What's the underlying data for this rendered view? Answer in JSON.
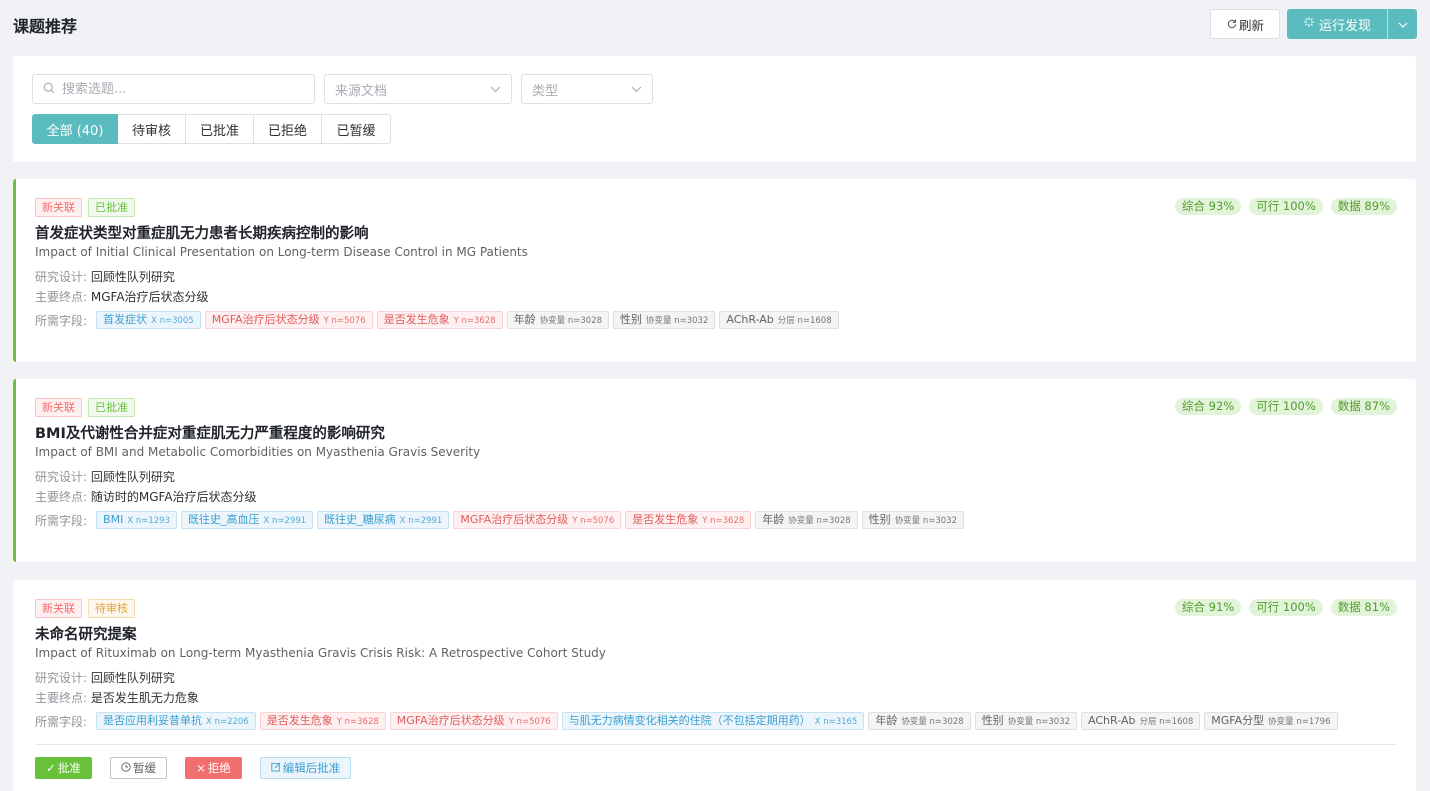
{
  "header": {
    "title": "课题推荐",
    "refresh_label": "刷新",
    "run_label": "运行发现"
  },
  "filters": {
    "search_placeholder": "搜索选题...",
    "source_placeholder": "来源文档",
    "type_placeholder": "类型",
    "tabs": [
      "全部 (40)",
      "待审核",
      "已批准",
      "已拒绝",
      "已暂缓"
    ],
    "active_tab": 0
  },
  "labels": {
    "design": "研究设计:",
    "endpoint": "主要终点:",
    "fields": "所需字段:"
  },
  "colors": {
    "accent": "#5bbcc0",
    "approved": "#67c23a",
    "reject": "#f26f6f",
    "pending": "#e6a23c"
  },
  "topics": [
    {
      "tag_new": "新关联",
      "tag_status": "已批准",
      "scores": [
        "综合 93%",
        "可行 100%",
        "数据 89%"
      ],
      "title": "首发症状类型对重症肌无力患者长期疾病控制的影响",
      "subtitle": "Impact of Initial Clinical Presentation on Long-term Disease Control in MG Patients",
      "design": "回顾性队列研究",
      "endpoint": "MGFA治疗后状态分级",
      "fields": [
        {
          "name": "首发症状",
          "meta": "X n=3005",
          "kind": "x"
        },
        {
          "name": "MGFA治疗后状态分级",
          "meta": "Y n=5076",
          "kind": "y"
        },
        {
          "name": "是否发生危象",
          "meta": "Y n=3628",
          "kind": "y"
        },
        {
          "name": "年龄",
          "meta": "协变量 n=3028",
          "kind": "c"
        },
        {
          "name": "性别",
          "meta": "协变量 n=3032",
          "kind": "c"
        },
        {
          "name": "AChR-Ab",
          "meta": "分层 n=1608",
          "kind": "c"
        }
      ]
    },
    {
      "tag_new": "新关联",
      "tag_status": "已批准",
      "scores": [
        "综合 92%",
        "可行 100%",
        "数据 87%"
      ],
      "title": "BMI及代谢性合并症对重症肌无力严重程度的影响研究",
      "subtitle": "Impact of BMI and Metabolic Comorbidities on Myasthenia Gravis Severity",
      "design": "回顾性队列研究",
      "endpoint": "随访时的MGFA治疗后状态分级",
      "fields": [
        {
          "name": "BMI",
          "meta": "X n=1293",
          "kind": "x"
        },
        {
          "name": "既往史_高血压",
          "meta": "X n=2991",
          "kind": "x"
        },
        {
          "name": "既往史_糖尿病",
          "meta": "X n=2991",
          "kind": "x"
        },
        {
          "name": "MGFA治疗后状态分级",
          "meta": "Y n=5076",
          "kind": "y"
        },
        {
          "name": "是否发生危象",
          "meta": "Y n=3628",
          "kind": "y"
        },
        {
          "name": "年龄",
          "meta": "协变量 n=3028",
          "kind": "c"
        },
        {
          "name": "性别",
          "meta": "协变量 n=3032",
          "kind": "c"
        }
      ]
    },
    {
      "tag_new": "新关联",
      "tag_status": "待审核",
      "scores": [
        "综合 91%",
        "可行 100%",
        "数据 81%"
      ],
      "title": "未命名研究提案",
      "subtitle": "Impact of Rituximab on Long-term Myasthenia Gravis Crisis Risk: A Retrospective Cohort Study",
      "design": "回顾性队列研究",
      "endpoint": "是否发生肌无力危象",
      "fields": [
        {
          "name": "是否应用利妥昔单抗",
          "meta": "X n=2206",
          "kind": "x"
        },
        {
          "name": "是否发生危象",
          "meta": "Y n=3628",
          "kind": "y"
        },
        {
          "name": "MGFA治疗后状态分级",
          "meta": "Y n=5076",
          "kind": "y"
        },
        {
          "name": "与肌无力病情变化相关的住院（不包括定期用药）",
          "meta": "X n=3165",
          "kind": "x"
        },
        {
          "name": "年龄",
          "meta": "协变量 n=3028",
          "kind": "c"
        },
        {
          "name": "性别",
          "meta": "协变量 n=3032",
          "kind": "c"
        },
        {
          "name": "AChR-Ab",
          "meta": "分层 n=1608",
          "kind": "c"
        },
        {
          "name": "MGFA分型",
          "meta": "协变量 n=1796",
          "kind": "c"
        }
      ],
      "actions": {
        "approve": "批准",
        "hold": "暂缓",
        "reject": "拒绝",
        "edit_approve": "编辑后批准"
      }
    }
  ]
}
